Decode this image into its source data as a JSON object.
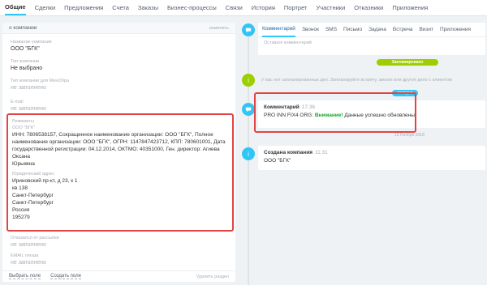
{
  "topnav": {
    "tabs": [
      {
        "label": "Общие",
        "active": true
      },
      {
        "label": "Сделки"
      },
      {
        "label": "Предложения"
      },
      {
        "label": "Счета"
      },
      {
        "label": "Заказы"
      },
      {
        "label": "Бизнес-процессы"
      },
      {
        "label": "Связи"
      },
      {
        "label": "История"
      },
      {
        "label": "Портрет"
      },
      {
        "label": "Участники"
      },
      {
        "label": "Отказники"
      },
      {
        "label": "Приложения"
      }
    ]
  },
  "left": {
    "title": "о компании",
    "edit": "изменить",
    "fields": [
      {
        "label": "Название компании",
        "value": "ООО \"БГК\""
      },
      {
        "label": "Тип компании",
        "value": "Не выбрано"
      },
      {
        "label": "Тип компании для МенОбра",
        "value": "не заполнено"
      },
      {
        "label": "E-mail",
        "value": "не заполнено"
      }
    ],
    "requisites": {
      "label": "Реквизиты",
      "name": "ООО \"БГК\"",
      "lines": [
        "ИНН: 7806538157, Сокращенное наименование организации: ООО \"БГК\", Полное",
        "наименование организации: ООО \"БГК\", ОГРН: 1147847423712, КПП: 780601001, Дата",
        "государственной регистрации: 04.12.2014, ОКТМО: 40351000, Ген. директор: Агиева Оксана",
        "Юрьевна"
      ],
      "addr_label": "Юридический адрес",
      "addr": [
        "Ириновский пр-кт, д 23, к 1",
        "кв 138",
        "Санкт-Петербург",
        "Санкт-Петербург",
        "Россия",
        "195279"
      ]
    },
    "after": [
      {
        "label": "Отказался от рассылки",
        "value": "не заполнено"
      },
      {
        "label": "EMAIL отказа",
        "value": "не заполнено"
      }
    ],
    "footer": {
      "choose": "Выбрать поле",
      "create": "Создать поле",
      "delete": "Удалить раздел"
    }
  },
  "editor": {
    "tabs": [
      {
        "label": "Комментарий",
        "active": true
      },
      {
        "label": "Звонок"
      },
      {
        "label": "SMS"
      },
      {
        "label": "Письмо"
      },
      {
        "label": "Задача"
      },
      {
        "label": "Встреча"
      },
      {
        "label": "Визит"
      },
      {
        "label": "Приложения"
      }
    ],
    "placeholder": "Оставьте комментарий"
  },
  "timeline": {
    "planned_pill": "Запланировано",
    "notice": "У вас нет запланированных дел. Запланируйте встречу, звонок или другое дело с клиентом",
    "today_pill": "сегодня",
    "comment": {
      "title": "Комментарий",
      "time": "17:36",
      "prefix": "PRO INN FIX4 ORG:",
      "bold": "Внимание!",
      "rest": "Данные успешно обновлены!"
    },
    "date": "15 Ноября 2018",
    "created": {
      "title": "Создана компания",
      "time": "11:31",
      "name": "ООО \"БГК\""
    }
  },
  "colors": {
    "accent": "#2fc6f6",
    "highlight": "#e14444",
    "green": "#9dcf00"
  }
}
